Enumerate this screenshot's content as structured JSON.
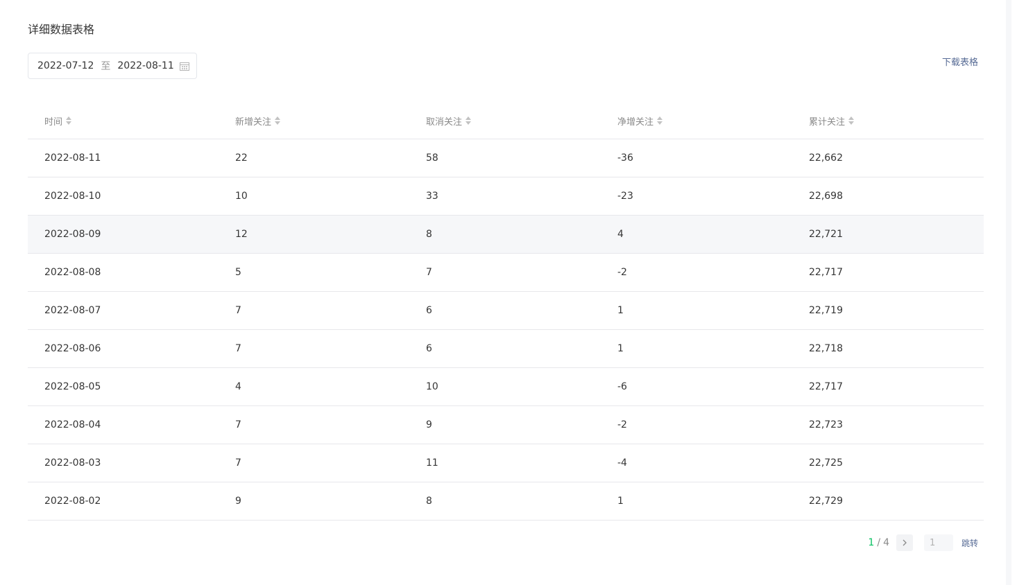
{
  "section_title": "详细数据表格",
  "date_range": {
    "start": "2022-07-12",
    "separator": "至",
    "end": "2022-08-11"
  },
  "download_label": "下载表格",
  "table": {
    "headers": [
      "时间",
      "新增关注",
      "取消关注",
      "净增关注",
      "累计关注"
    ],
    "rows": [
      [
        "2022-08-11",
        "22",
        "58",
        "-36",
        "22,662"
      ],
      [
        "2022-08-10",
        "10",
        "33",
        "-23",
        "22,698"
      ],
      [
        "2022-08-09",
        "12",
        "8",
        "4",
        "22,721"
      ],
      [
        "2022-08-08",
        "5",
        "7",
        "-2",
        "22,717"
      ],
      [
        "2022-08-07",
        "7",
        "6",
        "1",
        "22,719"
      ],
      [
        "2022-08-06",
        "7",
        "6",
        "1",
        "22,718"
      ],
      [
        "2022-08-05",
        "4",
        "10",
        "-6",
        "22,717"
      ],
      [
        "2022-08-04",
        "7",
        "9",
        "-2",
        "22,723"
      ],
      [
        "2022-08-03",
        "7",
        "11",
        "-4",
        "22,725"
      ],
      [
        "2022-08-02",
        "9",
        "8",
        "1",
        "22,729"
      ]
    ],
    "highlighted_row": 2
  },
  "pagination": {
    "current": "1",
    "separator": "/",
    "total": "4",
    "input_placeholder": "1",
    "jump_label": "跳转"
  },
  "icons": {
    "calendar": "calendar-icon",
    "sort": "sort-icon",
    "next": "chevron-right-icon"
  },
  "colors": {
    "link": "#576b95",
    "current_page": "#07c160",
    "row_hover": "#f6f7f9"
  }
}
